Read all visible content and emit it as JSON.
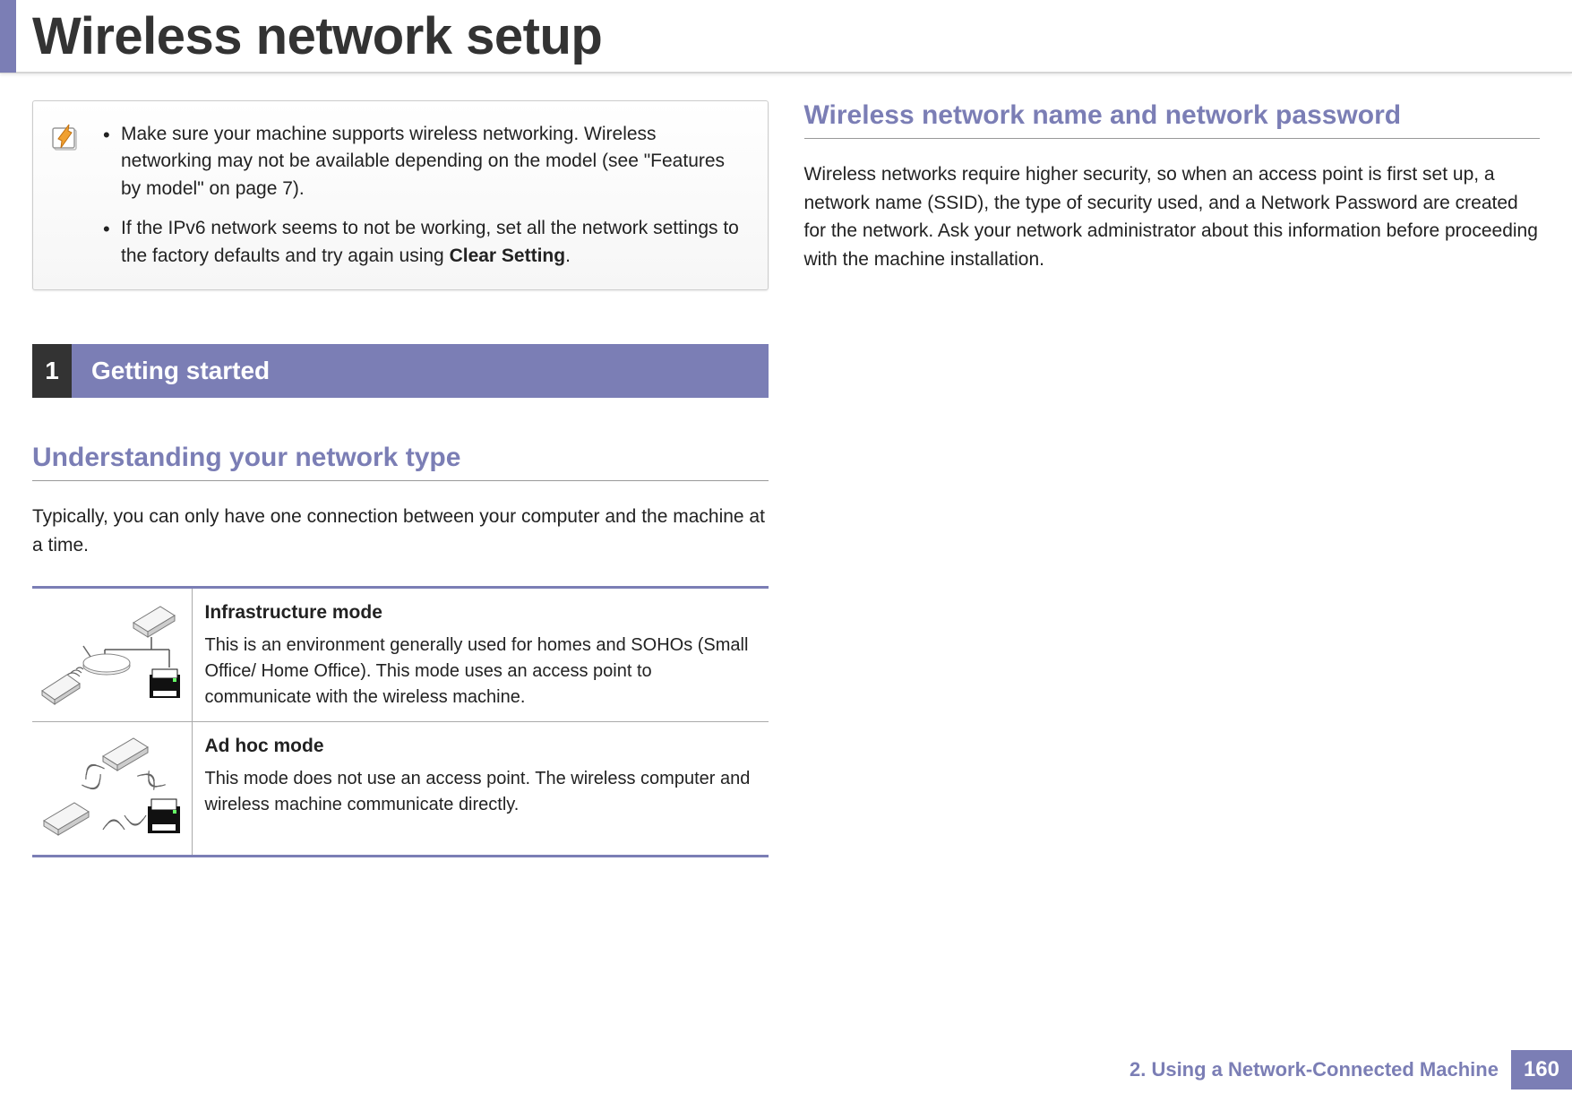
{
  "header": {
    "title": "Wireless network setup"
  },
  "left": {
    "note": {
      "item1_pre": "Make sure your machine supports wireless networking. Wireless networking may not be available depending on the model (see \"Features by model\" on page 7).",
      "item2_pre": "If the IPv6 network seems to not be working, set all the network settings to the factory defaults and try again using ",
      "item2_bold": "Clear Setting",
      "item2_post": "."
    },
    "section": {
      "num": "1",
      "label": "Getting started"
    },
    "subhead1": "Understanding your network type",
    "body1": "Typically, you can only have one connection between your computer and the machine at a time.",
    "modes": {
      "infra": {
        "title": "Infrastructure mode",
        "desc": "This is an environment generally used for homes and SOHOs (Small Office/ Home Office). This mode uses an access point to communicate with the wireless machine."
      },
      "adhoc": {
        "title": "Ad hoc mode",
        "desc": "This mode does not use an access point. The wireless computer and wireless machine communicate directly."
      }
    }
  },
  "right": {
    "subhead": "Wireless network name and network password",
    "body": "Wireless networks require higher security, so when an access point is first set up, a network name (SSID), the type of security used, and a Network Password are created for the network. Ask your network administrator about this information before proceeding with the machine installation."
  },
  "footer": {
    "chapter": "2.  Using a Network-Connected Machine",
    "page": "160"
  }
}
